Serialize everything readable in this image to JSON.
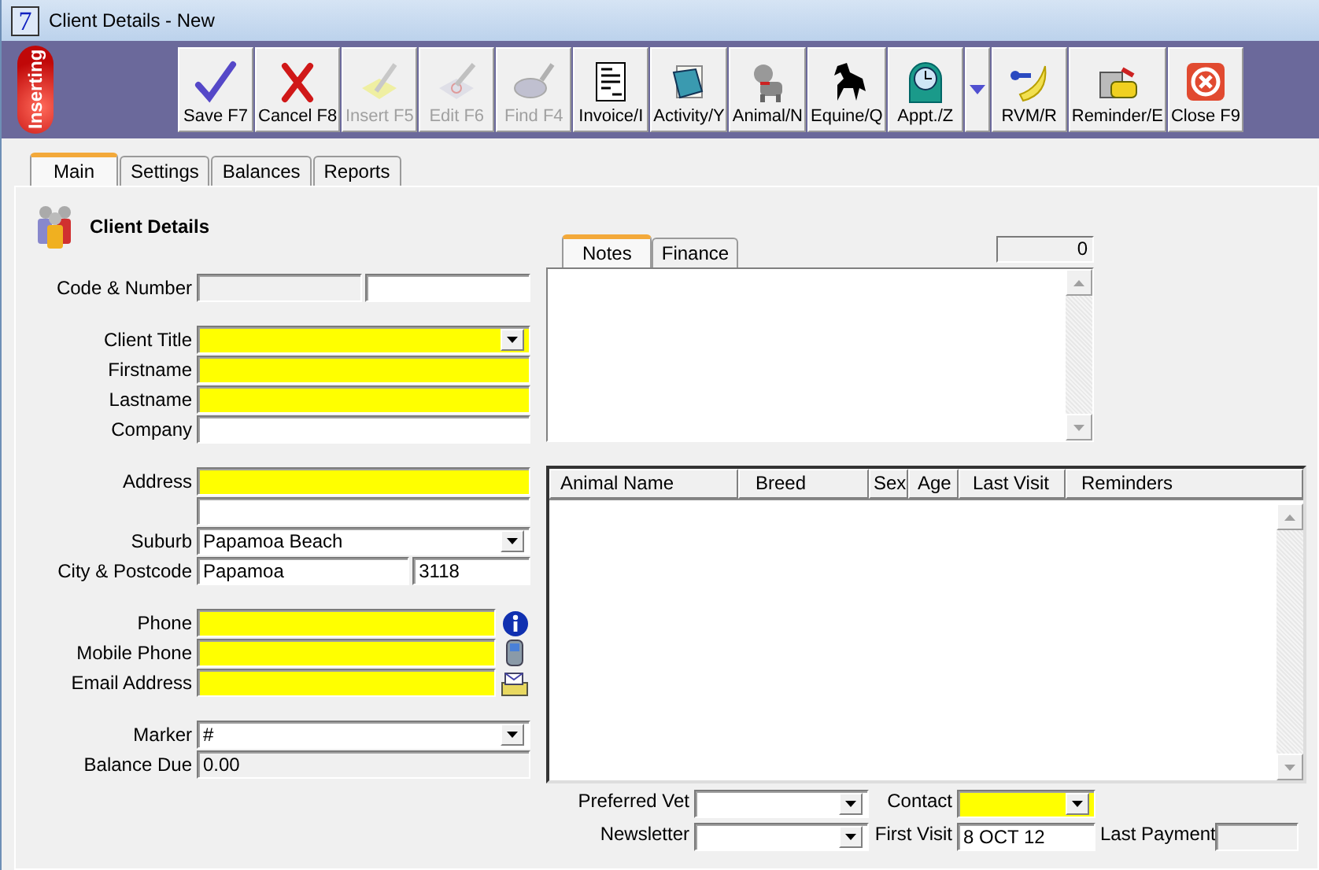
{
  "window": {
    "title": "Client Details - New",
    "app_icon": "7"
  },
  "mode_badge": "Inserting",
  "toolbar": [
    {
      "kind": "save",
      "label": "Save F7",
      "disabled": false
    },
    {
      "kind": "cancel",
      "label": "Cancel F8",
      "disabled": false
    },
    {
      "kind": "insert",
      "label": "Insert F5",
      "disabled": true
    },
    {
      "kind": "edit",
      "label": "Edit F6",
      "disabled": true
    },
    {
      "kind": "find",
      "label": "Find F4",
      "disabled": true
    },
    {
      "kind": "invoice",
      "label": "Invoice/I",
      "disabled": false
    },
    {
      "kind": "activity",
      "label": "Activity/Y",
      "disabled": false
    },
    {
      "kind": "animal",
      "label": "Animal/N",
      "disabled": false
    },
    {
      "kind": "equine",
      "label": "Equine/Q",
      "disabled": false
    },
    {
      "kind": "appointment",
      "label": "Appt./Z",
      "disabled": false
    },
    {
      "kind": "arrow"
    },
    {
      "kind": "rvm",
      "label": "RVM/R",
      "disabled": false
    },
    {
      "kind": "reminder",
      "label": "Reminder/E",
      "disabled": false
    },
    {
      "kind": "close",
      "label": "Close F9",
      "disabled": false
    }
  ],
  "tabs": [
    {
      "label": "Main",
      "selected": true
    },
    {
      "label": "Settings",
      "selected": false
    },
    {
      "label": "Balances",
      "selected": false
    },
    {
      "label": "Reports",
      "selected": false
    }
  ],
  "section_title": "Client Details",
  "form_groups": [
    {
      "rows": [
        {
          "label": "Code & Number",
          "inputs": [
            {
              "kind": "readonly",
              "required": false
            },
            {
              "kind": "text",
              "required": false
            }
          ]
        }
      ]
    },
    {
      "rows": [
        {
          "label": "Client Title",
          "inputs": [
            {
              "kind": "dropdown",
              "required": true
            }
          ]
        },
        {
          "label": "Firstname",
          "inputs": [
            {
              "kind": "text",
              "required": true
            }
          ]
        },
        {
          "label": "Lastname",
          "inputs": [
            {
              "kind": "text",
              "required": true
            }
          ]
        },
        {
          "label": "Company",
          "inputs": [
            {
              "kind": "text",
              "required": false
            }
          ]
        }
      ]
    },
    {
      "rows": [
        {
          "label": "Address",
          "inputs": [
            {
              "kind": "text",
              "required": true
            }
          ]
        },
        {
          "inputs": [
            {
              "kind": "text",
              "required": false
            }
          ]
        },
        {
          "label": "Suburb",
          "inputs": [
            {
              "kind": "dropdown",
              "required": false,
              "value": "Papamoa Beach"
            }
          ]
        },
        {
          "label": "City & Postcode",
          "inputs": [
            {
              "kind": "text",
              "required": false,
              "value": "Papamoa"
            },
            {
              "kind": "text",
              "required": false,
              "value": "3118"
            }
          ]
        }
      ]
    },
    {
      "rows": [
        {
          "label": "Phone",
          "inputs": [
            {
              "kind": "text",
              "required": true
            }
          ],
          "side_button": {
            "kind": "info"
          }
        },
        {
          "label": "Mobile Phone",
          "inputs": [
            {
              "kind": "text",
              "required": true
            }
          ],
          "side_button": {
            "kind": "mobile"
          }
        },
        {
          "label": "Email Address",
          "inputs": [
            {
              "kind": "text",
              "required": true
            }
          ],
          "side_button": {
            "kind": "email"
          }
        }
      ]
    },
    {
      "rows": [
        {
          "label": "Marker",
          "inputs": [
            {
              "kind": "dropdown",
              "required": false,
              "value": "#"
            }
          ]
        },
        {
          "label": "Balance Due",
          "inputs": [
            {
              "kind": "readonly",
              "required": false,
              "value": "0.00"
            }
          ]
        }
      ]
    }
  ],
  "notes": {
    "tabs": [
      {
        "label": "Notes",
        "selected": true
      },
      {
        "label": "Finance",
        "selected": false
      }
    ],
    "counter": "0"
  },
  "animals_table": {
    "columns": [
      "Animal Name",
      "Breed",
      "Sex",
      "Age",
      "Last Visit",
      "Reminders"
    ]
  },
  "bottom_fields": [
    [
      {
        "label": "Preferred Vet",
        "kind": "dropdown",
        "required": false
      },
      {
        "label": "Contact",
        "kind": "dropdown",
        "required": true
      }
    ],
    [
      {
        "label": "Newsletter",
        "kind": "dropdown",
        "required": false
      },
      {
        "label": "First Visit",
        "kind": "text",
        "required": false,
        "value": "8 OCT 12"
      },
      {
        "label": "Last Payment",
        "kind": "readonly",
        "required": false
      }
    ]
  ]
}
